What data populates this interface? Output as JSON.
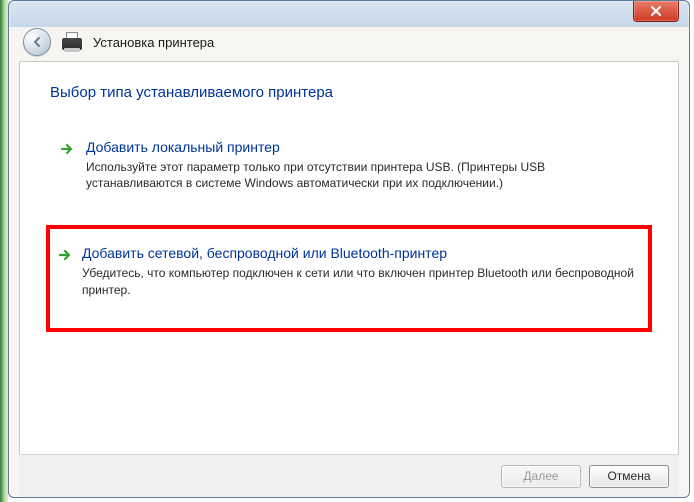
{
  "window": {
    "title": "Установка принтера"
  },
  "page": {
    "heading": "Выбор типа устанавливаемого принтера"
  },
  "options": [
    {
      "title": "Добавить локальный принтер",
      "desc": "Используйте этот параметр только при отсутствии принтера USB. (Принтеры USB устанавливаются в системе Windows автоматически при их подключении.)"
    },
    {
      "title": "Добавить сетевой, беспроводной или Bluetooth-принтер",
      "desc": "Убедитесь, что компьютер подключен к сети или что включен принтер Bluetooth или беспроводной принтер."
    }
  ],
  "footer": {
    "next": "Далее",
    "cancel": "Отмена"
  }
}
